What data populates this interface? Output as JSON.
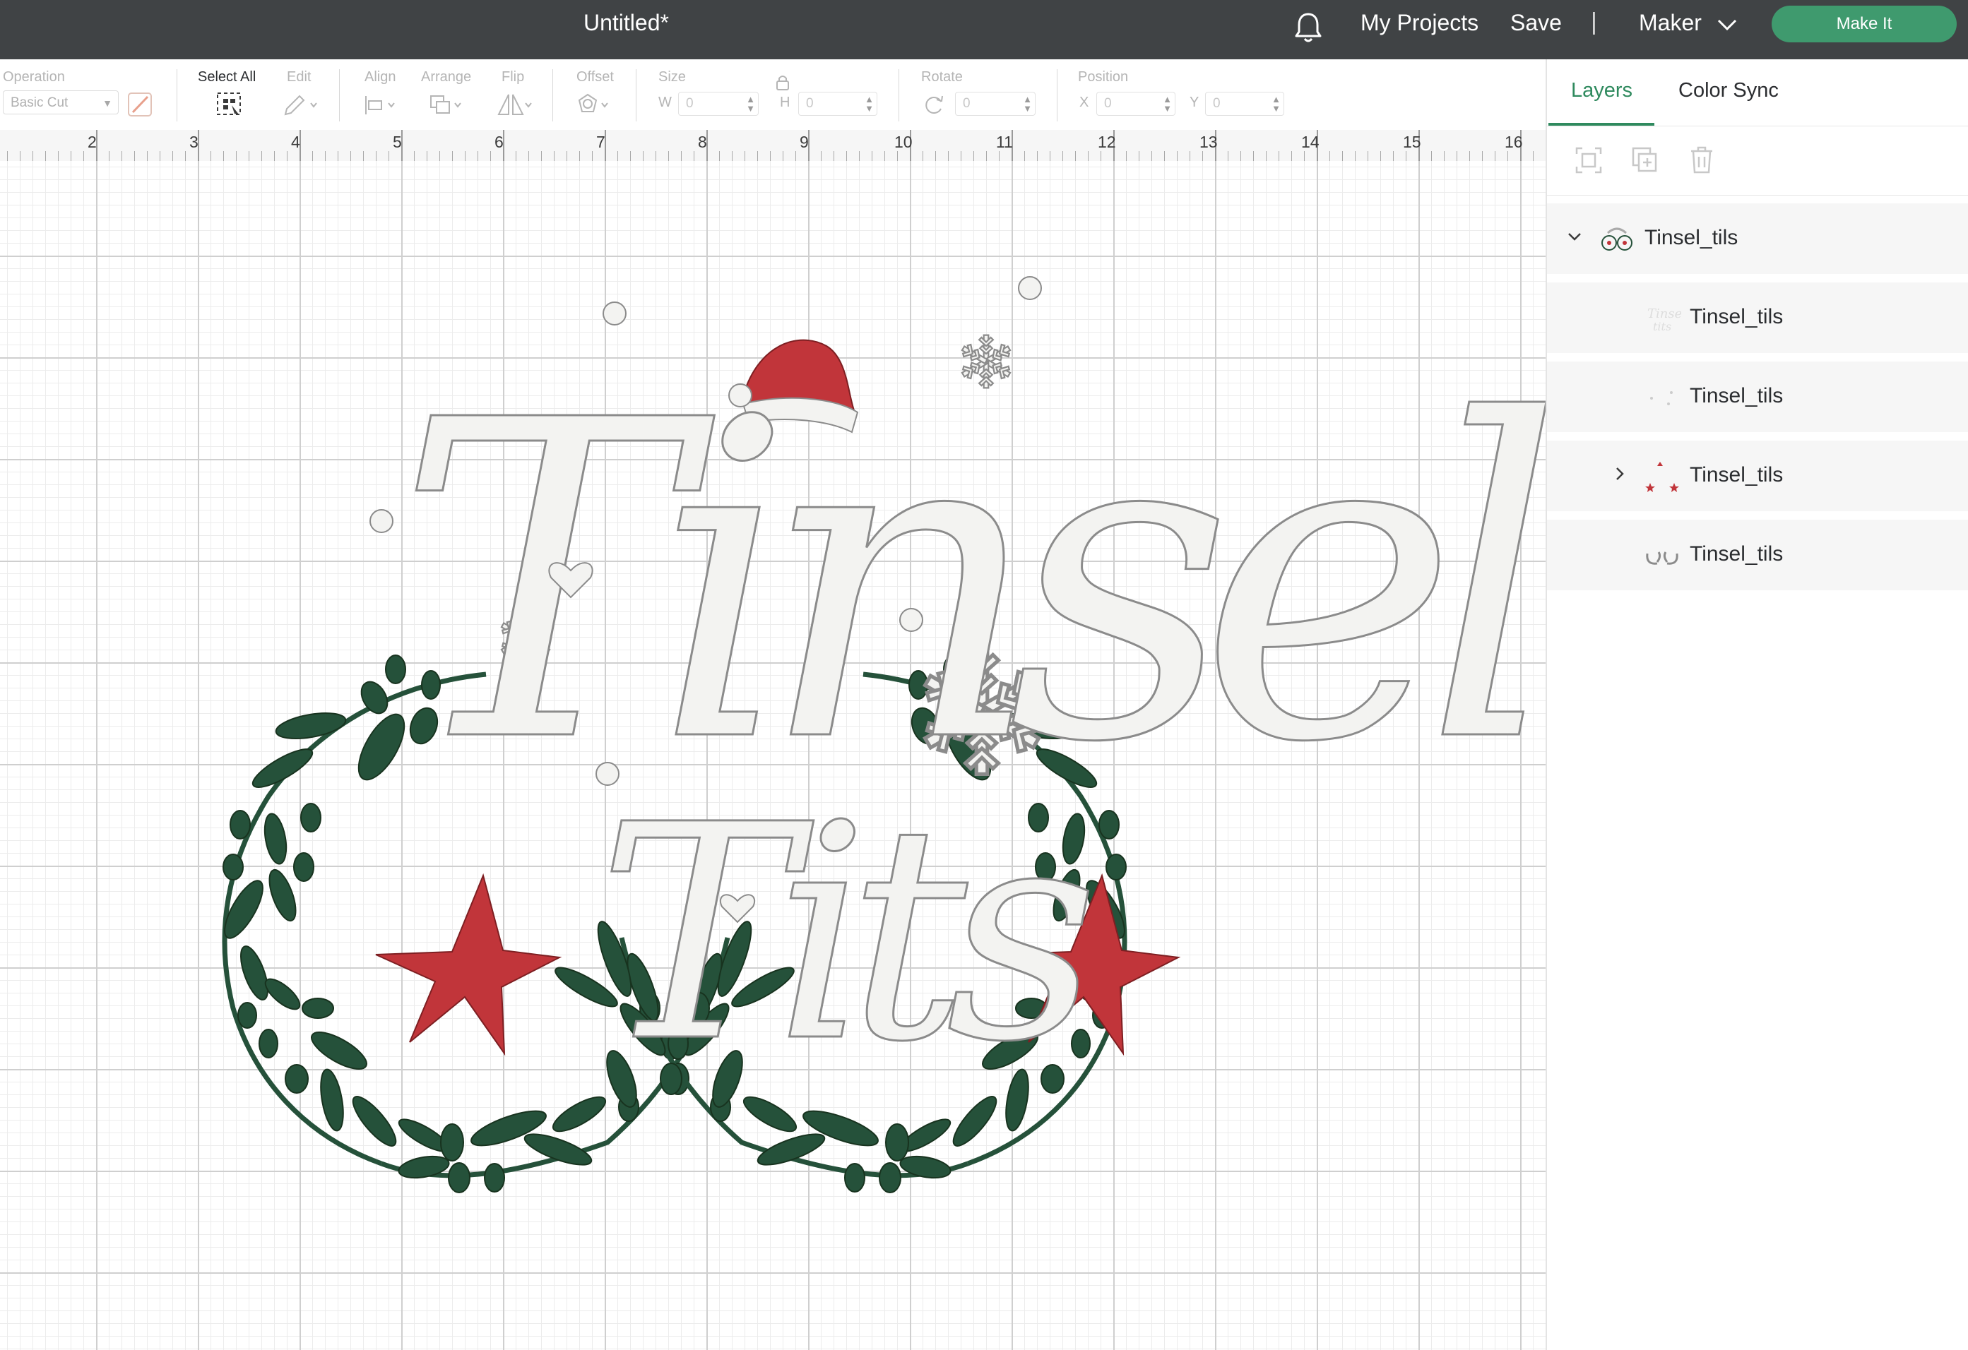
{
  "header": {
    "doc_title": "Untitled*",
    "my_projects": "My Projects",
    "save": "Save",
    "separator": "|",
    "machine": "Maker",
    "make_it": "Make It"
  },
  "toolbar": {
    "operation_label": "Operation",
    "operation_value": "Basic Cut",
    "select_all_label": "Select All",
    "edit_label": "Edit",
    "align_label": "Align",
    "arrange_label": "Arrange",
    "flip_label": "Flip",
    "offset_label": "Offset",
    "size_label": "Size",
    "w_label": "W",
    "w_value": "0",
    "h_label": "H",
    "h_value": "0",
    "rotate_label": "Rotate",
    "rotate_value": "0",
    "position_label": "Position",
    "x_label": "X",
    "x_value": "0",
    "y_label": "Y",
    "y_value": "0"
  },
  "ruler": {
    "ticks": [
      "2",
      "3",
      "4",
      "5",
      "6",
      "7",
      "8",
      "9",
      "10",
      "11",
      "12",
      "13",
      "14",
      "15",
      "16"
    ]
  },
  "canvas": {
    "design_word_1": "Tinsel",
    "design_word_2": "Tits",
    "colors": {
      "lettering_fill": "#f3f3f1",
      "lettering_stroke": "#8b8b8b",
      "hat_red": "#c1353a",
      "star_red": "#c1353a",
      "leaf_green": "#25513a"
    }
  },
  "panel": {
    "tabs": [
      "Layers",
      "Color Sync"
    ],
    "active_tab": "Layers",
    "tools": [
      "group-icon",
      "duplicate-icon",
      "delete-icon"
    ],
    "layers": [
      {
        "name": "Tinsel_tils",
        "level": "group",
        "expanded": true
      },
      {
        "name": "Tinsel_tils",
        "level": "child"
      },
      {
        "name": "Tinsel_tils",
        "level": "child"
      },
      {
        "name": "Tinsel_tils",
        "level": "child",
        "expandable": true
      },
      {
        "name": "Tinsel_tils",
        "level": "child"
      }
    ]
  },
  "colors": {
    "topbar": "#404345",
    "accent_green": "#3f9a6e",
    "tab_green": "#2f8a5e"
  }
}
